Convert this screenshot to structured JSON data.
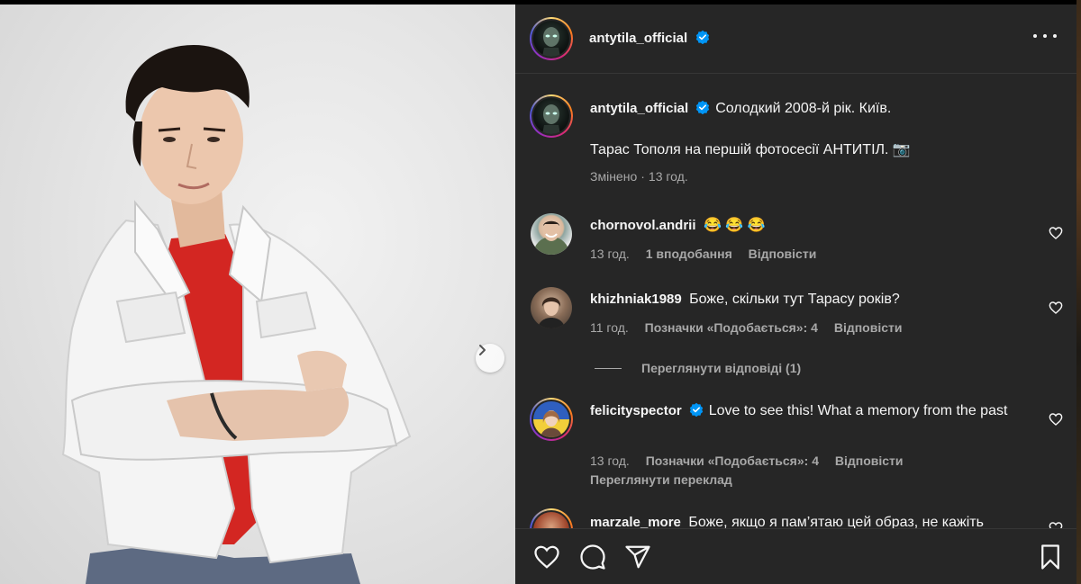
{
  "post": {
    "author": "antytila_official",
    "more_label": "More options"
  },
  "caption": {
    "username": "antytila_official",
    "text_line1": "Солодкий 2008-й рік. Київ.",
    "text_line2": "Тарас Тополя на першій фотосесії АНТИТІЛ. 📷",
    "edited": "Змінено",
    "time": "13 год."
  },
  "comments": [
    {
      "username": "chornovol.andrii",
      "text": "😂 😂 😂",
      "verified": false,
      "time": "13 год.",
      "likes": "1 вподобання",
      "reply": "Відповісти"
    },
    {
      "username": "khizhniak1989",
      "text": "Боже, скільки тут Тарасу років?",
      "verified": false,
      "time": "11 год.",
      "likes": "Позначки «Подобається»: 4",
      "reply": "Відповісти",
      "view_replies": "Переглянути відповіді (1)"
    },
    {
      "username": "felicityspector",
      "text": "Love to see this! What a memory from the past",
      "verified": true,
      "time": "13 год.",
      "likes": "Позначки «Подобається»: 4",
      "reply": "Відповісти",
      "translate": "Переглянути переклад"
    },
    {
      "username": "marzale_more",
      "text": "Боже, якщо я пам’ятаю цей образ, не кажіть",
      "verified": false
    }
  ],
  "colors": {
    "panel_bg": "#262626",
    "text_primary": "#f5f5f5",
    "text_secondary": "#a8a8a8",
    "verified_blue": "#0095f6"
  },
  "icons": [
    "heart-icon",
    "comment-icon",
    "share-icon",
    "bookmark-icon",
    "chevron-right-icon",
    "verified-badge-icon",
    "more-icon"
  ]
}
